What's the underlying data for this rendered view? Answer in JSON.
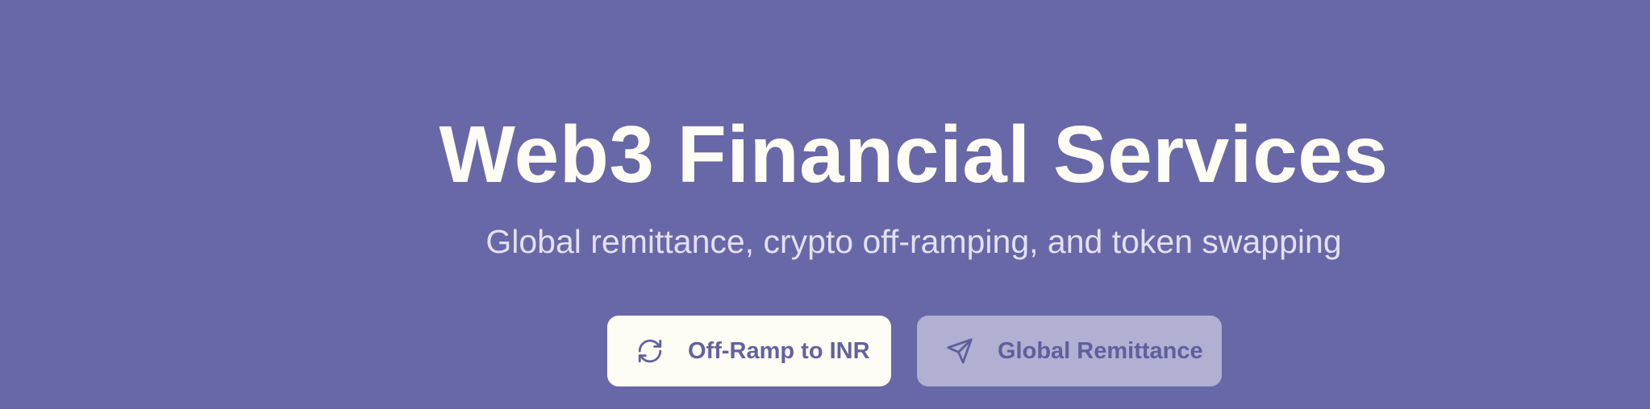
{
  "hero": {
    "title": "Web3 Financial Services",
    "subtitle": "Global remittance, crypto off-ramping, and token swapping"
  },
  "actions": {
    "offramp": {
      "label": "Off-Ramp to INR",
      "icon": "refresh-icon"
    },
    "remittance": {
      "label": "Global Remittance",
      "icon": "send-icon"
    }
  },
  "colors": {
    "background": "#6867a7",
    "title": "#fdfdf5",
    "subtitle": "#e2e1f0",
    "primary_button_bg": "#fdfdf5",
    "secondary_button_bg": "#b1b0d2",
    "button_text": "#62629f"
  }
}
